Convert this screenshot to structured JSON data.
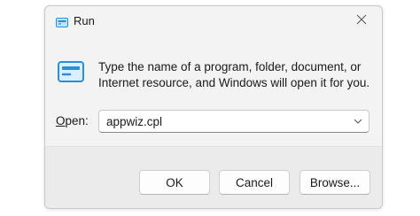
{
  "window": {
    "title": "Run",
    "icon": "run-icon",
    "close_icon": "close-icon"
  },
  "main": {
    "icon": "run-icon",
    "message": "Type the name of a program, folder, document, or Internet resource, and Windows will open it for you."
  },
  "open_field": {
    "label_prefix": "O",
    "label_rest": "pen:",
    "value": "appwiz.cpl",
    "dropdown_icon": "chevron-down-icon"
  },
  "buttons": {
    "ok": "OK",
    "cancel": "Cancel",
    "browse": "Browse..."
  },
  "colors": {
    "icon_blue": "#2b8fd6",
    "icon_light": "#bfe3fb"
  }
}
